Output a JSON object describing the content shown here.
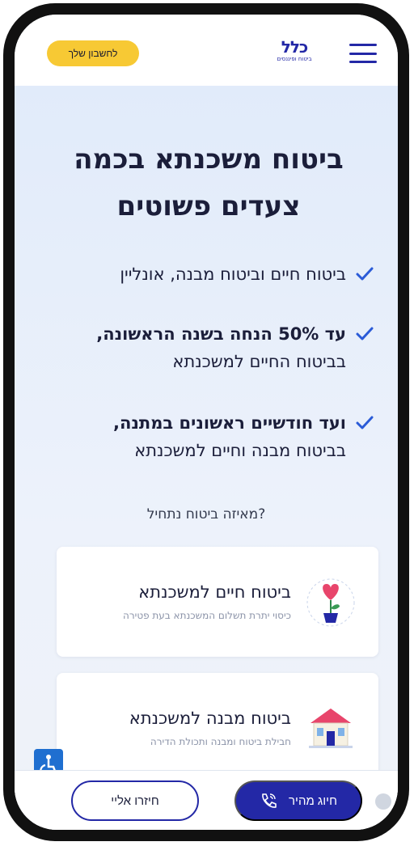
{
  "header": {
    "account_label": "לחשבון שלך",
    "logo_word": "כלל",
    "logo_tagline": "ביטוח ופיננסים"
  },
  "hero": {
    "title": "ביטוח משכנתא בכמה צעדים פשוטים",
    "benefits": [
      {
        "bold": "",
        "text": "ביטוח חיים וביטוח מבנה, אונליין"
      },
      {
        "bold": "עד 50% הנחה בשנה הראשונה,",
        "text": "בביטוח החיים למשכנתא"
      },
      {
        "bold": "ועד חודשיים ראשונים במתנה,",
        "text": "בביטוח מבנה וחיים למשכנתא"
      }
    ],
    "question": "?מאיזה ביטוח נתחיל"
  },
  "cards": [
    {
      "title": "ביטוח חיים למשכנתא",
      "subtitle": "כיסוי יתרת תשלום המשכנתא בעת פטירה",
      "icon": "heart-plant-icon"
    },
    {
      "title": "ביטוח מבנה למשכנתא",
      "subtitle": "חבילת ביטוח ומבנה ותכולת הדירה",
      "icon": "house-icon"
    }
  ],
  "bottom_bar": {
    "dial_label": "חיוג מהיר",
    "callback_label": "חיזרו אליי"
  },
  "colors": {
    "brand": "#2328a6",
    "accent": "#f7c934",
    "check": "#2b5bd7"
  }
}
